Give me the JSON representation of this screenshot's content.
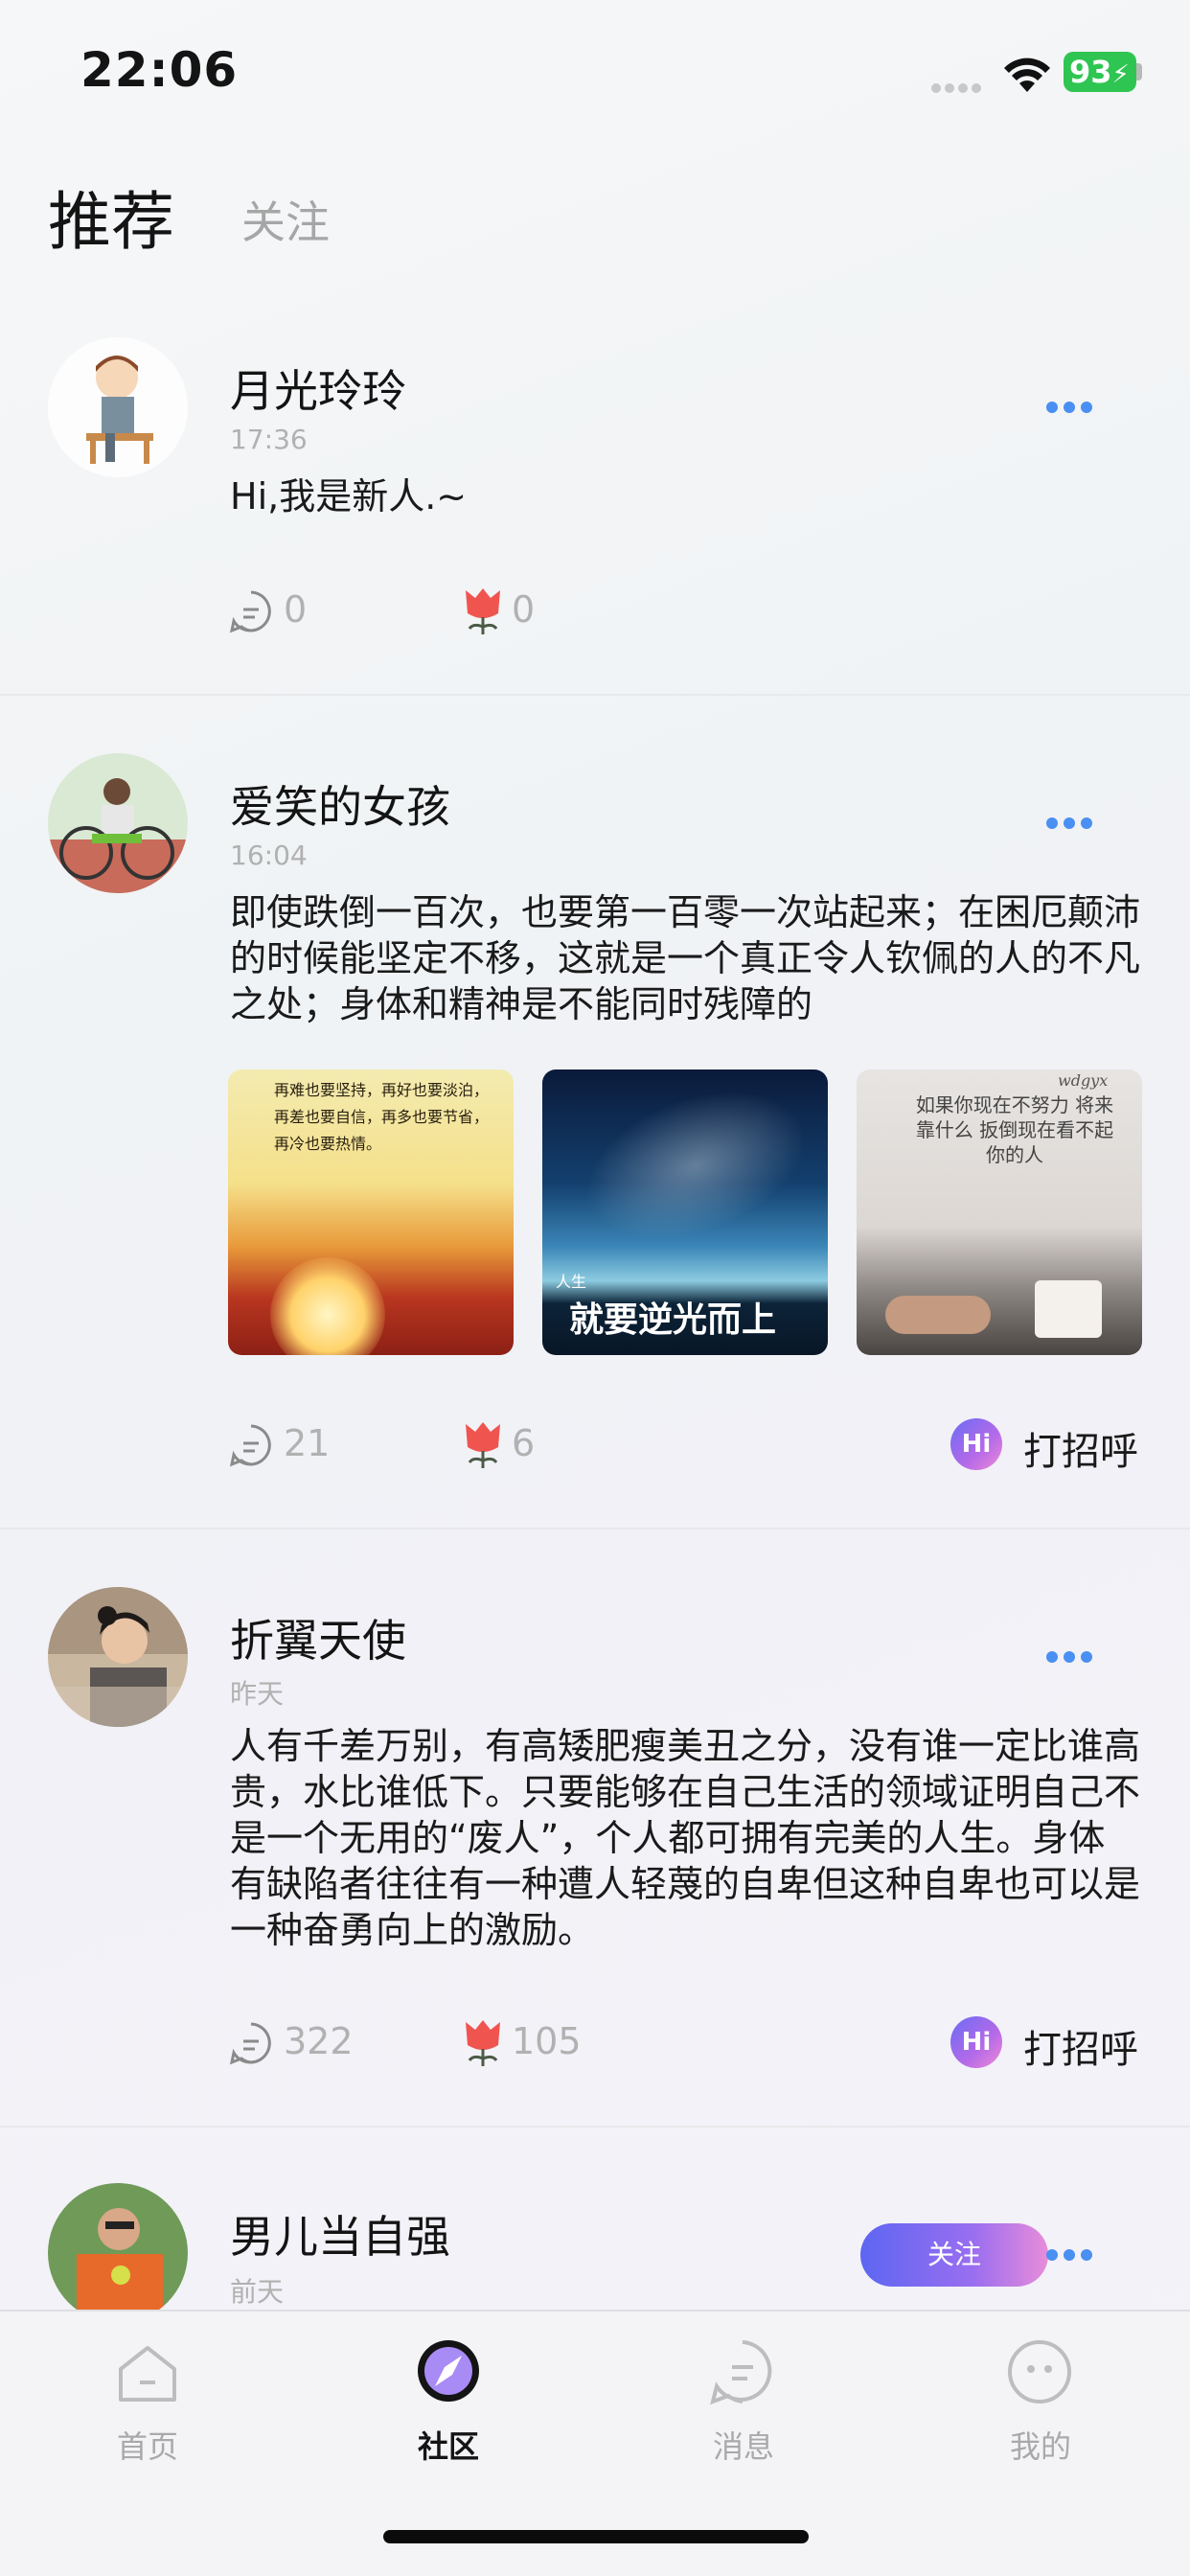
{
  "status_bar": {
    "time": "22:06",
    "battery": "93"
  },
  "tabs": {
    "active": "推荐",
    "inactive": "关注"
  },
  "posts": [
    {
      "username": "月光玲玲",
      "time": "17:36",
      "text": "Hi,我是新人.~",
      "comments": "0",
      "likes": "0"
    },
    {
      "username": "爱笑的女孩",
      "time": "16:04",
      "text": "即使跌倒一百次，也要第一百零一次站起来；在困厄颠沛的时候能坚定不移，这就是一个真正令人钦佩的人的不凡之处；身体和精神是不能同时残障的",
      "comments": "21",
      "likes": "6",
      "greet": "打招呼",
      "hi": "Hi",
      "images": [
        {
          "caption": "再难也要坚持，再好也要淡泊，再差也要自信，再多也要节省，再冷也要热情。"
        },
        {
          "caption_small": "人生",
          "caption": "就要逆光而上"
        },
        {
          "caption": "如果你现在不努力 将来靠什么 扳倒现在看不起你的人",
          "watermark": "wdgyx"
        }
      ]
    },
    {
      "username": "折翼天使",
      "time": "昨天",
      "text": "人有千差万别，有高矮肥瘦美丑之分，没有谁一定比谁高贵，水比谁低下。只要能够在自己生活的领域证明自己不是一个无用的“废人”，个人都可拥有完美的人生。身体有缺陷者往往有一种遭人轻蔑的自卑但这种自卑也可以是一种奋勇向上的激励。",
      "comments": "322",
      "likes": "105",
      "greet": "打招呼",
      "hi": "Hi"
    },
    {
      "username": "男儿当自强",
      "time": "前天",
      "follow": "关注"
    }
  ],
  "nav": [
    {
      "label": "首页",
      "icon": "home-icon"
    },
    {
      "label": "社区",
      "icon": "compass-icon"
    },
    {
      "label": "消息",
      "icon": "message-icon"
    },
    {
      "label": "我的",
      "icon": "profile-icon"
    }
  ],
  "colors": {
    "accent": "#4a8ff2",
    "battery": "#2fc552",
    "like": "#f0544f"
  }
}
